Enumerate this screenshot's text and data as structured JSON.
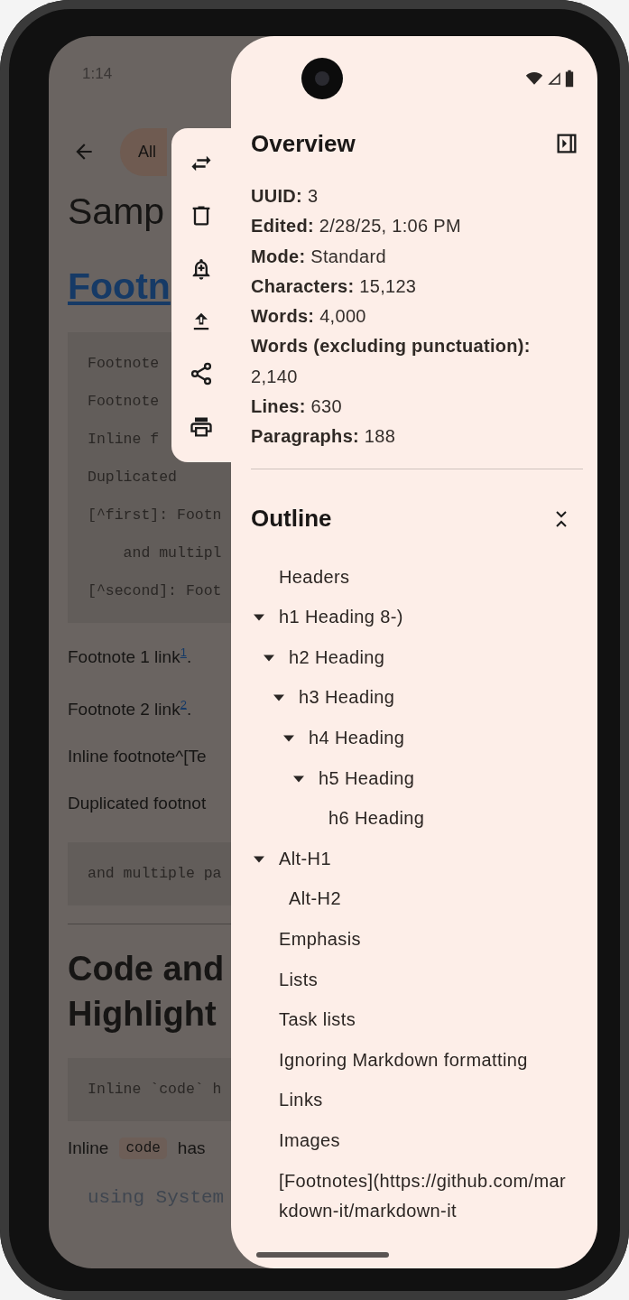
{
  "status_bar": {
    "time": "1:14"
  },
  "document": {
    "filter_chip": "All",
    "blocks": [
      {
        "kind": "title",
        "text": "Samp"
      },
      {
        "kind": "link_heading",
        "text": "Footn"
      },
      {
        "kind": "code",
        "lines": [
          "Footnote",
          "Footnote",
          "Inline f",
          "Duplicated",
          "[^first]: Footn",
          "    and multipl",
          "[^second]: Foot"
        ]
      },
      {
        "kind": "paragraph",
        "text": "Footnote 1 link$^{1}$."
      },
      {
        "kind": "paragraph",
        "text": "Footnote 2 link$^{2}$."
      },
      {
        "kind": "paragraph",
        "text": "Inline footnote^[Te"
      },
      {
        "kind": "paragraph",
        "text": "Duplicated footnot"
      },
      {
        "kind": "code",
        "lines": [
          "and multiple pa"
        ]
      },
      {
        "kind": "rule"
      },
      {
        "kind": "heading",
        "text": "Code and\nHighlight"
      },
      {
        "kind": "code",
        "lines": [
          "Inline `code` h"
        ]
      },
      {
        "kind": "inline",
        "parts": [
          {
            "kind": "text",
            "text": "Inline"
          },
          {
            "kind": "code",
            "text": "code"
          },
          {
            "kind": "text",
            "text": "has"
          }
        ]
      },
      {
        "kind": "code_plain",
        "lines": [
          "using System"
        ]
      }
    ]
  },
  "toolbar": {
    "actions": [
      {
        "kind": "swap"
      },
      {
        "kind": "delete"
      },
      {
        "kind": "reminder"
      },
      {
        "kind": "upload"
      },
      {
        "kind": "share"
      },
      {
        "kind": "print"
      }
    ]
  },
  "panel": {
    "overview": {
      "title": "Overview",
      "stats": [
        {
          "label": "UUID:",
          "value": "3"
        },
        {
          "label": "Edited:",
          "value": "2/28/25, 1:06 PM"
        },
        {
          "label": "Mode:",
          "value": "Standard"
        },
        {
          "label": "Characters:",
          "value": "15,123"
        },
        {
          "label": "Words:",
          "value": "4,000"
        },
        {
          "label": "Words (excluding punctuation):",
          "value": "2,140"
        },
        {
          "label": "Lines:",
          "value": "630"
        },
        {
          "label": "Paragraphs:",
          "value": "188"
        }
      ]
    },
    "outline": {
      "title": "Outline",
      "items": [
        {
          "text": "Headers"
        },
        {
          "text": "h1 Heading 8-)",
          "expanded": true,
          "children": [
            {
              "text": "h2 Heading",
              "expanded": true,
              "children": [
                {
                  "text": "h3 Heading",
                  "expanded": true,
                  "children": [
                    {
                      "text": "h4 Heading",
                      "expanded": true,
                      "children": [
                        {
                          "text": "h5 Heading",
                          "expanded": true,
                          "children": [
                            {
                              "text": "h6 Heading"
                            }
                          ]
                        }
                      ]
                    }
                  ]
                }
              ]
            }
          ]
        },
        {
          "text": "Alt-H1",
          "expanded": true,
          "children": [
            {
              "text": "Alt-H2"
            }
          ]
        },
        {
          "text": "Emphasis"
        },
        {
          "text": "Lists"
        },
        {
          "text": "Task lists"
        },
        {
          "text": "Ignoring Markdown formatting"
        },
        {
          "text": "Links"
        },
        {
          "text": "Images"
        },
        {
          "text": "[Footnotes](https://github.com/markdown-it/markdown-it"
        }
      ]
    }
  }
}
